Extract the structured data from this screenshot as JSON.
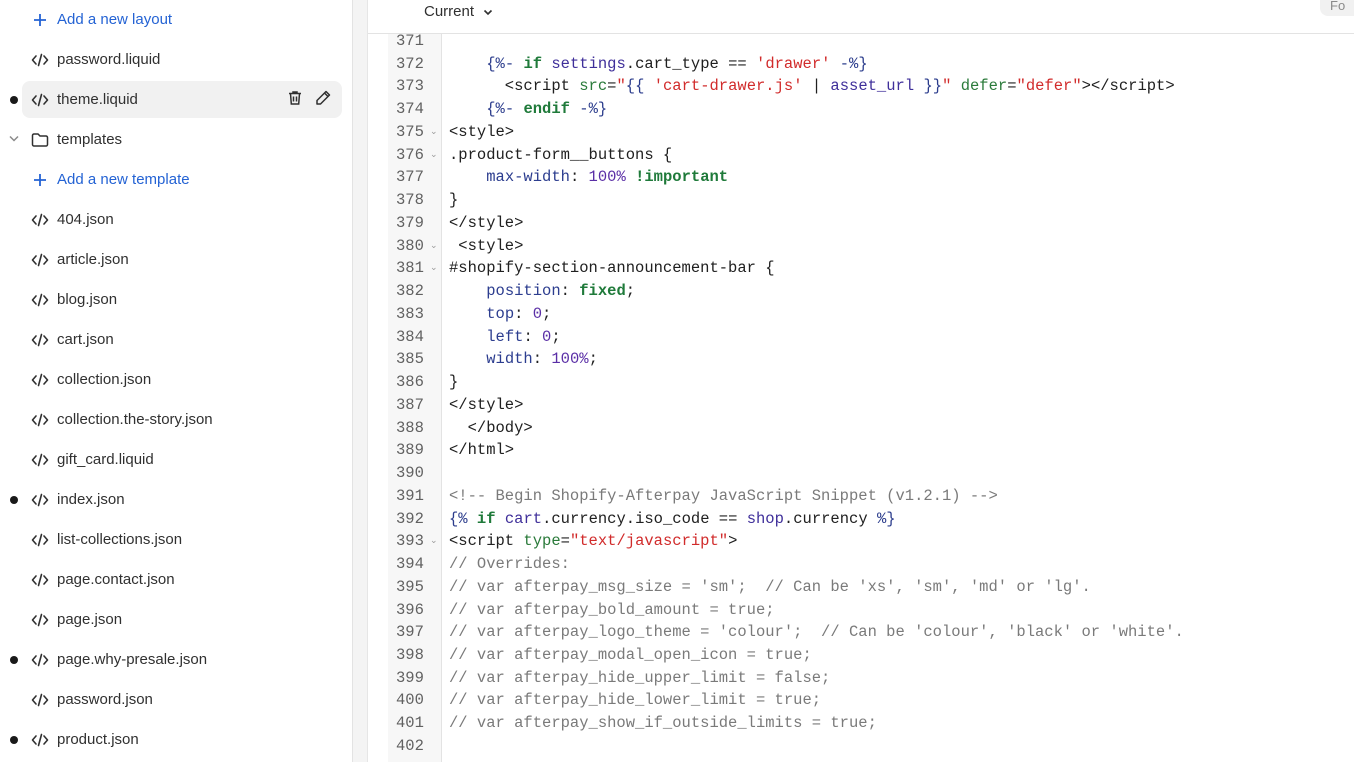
{
  "sidebar": {
    "items": [
      {
        "label": "Add a new layout",
        "type": "add"
      },
      {
        "label": "password.liquid",
        "type": "file"
      },
      {
        "label": "theme.liquid",
        "type": "file",
        "selected": true,
        "modified": true
      },
      {
        "label": "templates",
        "type": "folder"
      },
      {
        "label": "Add a new template",
        "type": "add"
      },
      {
        "label": "404.json",
        "type": "file"
      },
      {
        "label": "article.json",
        "type": "file"
      },
      {
        "label": "blog.json",
        "type": "file"
      },
      {
        "label": "cart.json",
        "type": "file"
      },
      {
        "label": "collection.json",
        "type": "file"
      },
      {
        "label": "collection.the-story.json",
        "type": "file"
      },
      {
        "label": "gift_card.liquid",
        "type": "file"
      },
      {
        "label": "index.json",
        "type": "file",
        "modified": true
      },
      {
        "label": "list-collections.json",
        "type": "file"
      },
      {
        "label": "page.contact.json",
        "type": "file"
      },
      {
        "label": "page.json",
        "type": "file"
      },
      {
        "label": "page.why-presale.json",
        "type": "file",
        "modified": true
      },
      {
        "label": "password.json",
        "type": "file"
      },
      {
        "label": "product.json",
        "type": "file",
        "modified": true
      }
    ]
  },
  "editor": {
    "version_label": "Current",
    "format_label": "Fo",
    "lines": [
      {
        "n": "371",
        "t": []
      },
      {
        "n": "372",
        "t": [
          [
            "",
            "    "
          ],
          [
            "del",
            "{%-"
          ],
          [
            "",
            " "
          ],
          [
            "kw",
            "if"
          ],
          [
            "",
            " "
          ],
          [
            "var",
            "settings"
          ],
          [
            "",
            ".cart_type == "
          ],
          [
            "str",
            "'drawer'"
          ],
          [
            "",
            " "
          ],
          [
            "del",
            "-%}"
          ]
        ]
      },
      {
        "n": "373",
        "t": [
          [
            "",
            "      <script "
          ],
          [
            "attr",
            "src"
          ],
          [
            "",
            "="
          ],
          [
            "str",
            "\""
          ],
          [
            "del",
            "{{"
          ],
          [
            "",
            " "
          ],
          [
            "str",
            "'cart-drawer.js'"
          ],
          [
            "",
            " | "
          ],
          [
            "var",
            "asset_url"
          ],
          [
            "",
            " "
          ],
          [
            "del",
            "}}"
          ],
          [
            "str",
            "\""
          ],
          [
            "",
            " "
          ],
          [
            "attr",
            "defer"
          ],
          [
            "",
            "="
          ],
          [
            "str",
            "\"defer\""
          ],
          [
            "",
            "></script>"
          ]
        ]
      },
      {
        "n": "374",
        "t": [
          [
            "",
            "    "
          ],
          [
            "del",
            "{%-"
          ],
          [
            "",
            " "
          ],
          [
            "kw",
            "endif"
          ],
          [
            "",
            " "
          ],
          [
            "del",
            "-%}"
          ]
        ]
      },
      {
        "n": "375",
        "fold": true,
        "t": [
          [
            "",
            "<style>"
          ]
        ]
      },
      {
        "n": "376",
        "fold": true,
        "t": [
          [
            "",
            ".product-form__buttons {"
          ]
        ]
      },
      {
        "n": "377",
        "t": [
          [
            "",
            "    "
          ],
          [
            "prop",
            "max-width"
          ],
          [
            "",
            ": "
          ],
          [
            "num",
            "100%"
          ],
          [
            "",
            " "
          ],
          [
            "kw",
            "!important"
          ]
        ]
      },
      {
        "n": "378",
        "t": [
          [
            "",
            "}"
          ]
        ]
      },
      {
        "n": "379",
        "t": [
          [
            "",
            "</style>"
          ]
        ]
      },
      {
        "n": "380",
        "fold": true,
        "t": [
          [
            "",
            " <style>"
          ]
        ]
      },
      {
        "n": "381",
        "fold": true,
        "t": [
          [
            "",
            "#shopify-section-announcement-bar {"
          ]
        ]
      },
      {
        "n": "382",
        "t": [
          [
            "",
            "    "
          ],
          [
            "prop",
            "position"
          ],
          [
            "",
            ": "
          ],
          [
            "kw",
            "fixed"
          ],
          [
            "",
            ";"
          ]
        ]
      },
      {
        "n": "383",
        "t": [
          [
            "",
            "    "
          ],
          [
            "prop",
            "top"
          ],
          [
            "",
            ": "
          ],
          [
            "num",
            "0"
          ],
          [
            "",
            ";"
          ]
        ]
      },
      {
        "n": "384",
        "t": [
          [
            "",
            "    "
          ],
          [
            "prop",
            "left"
          ],
          [
            "",
            ": "
          ],
          [
            "num",
            "0"
          ],
          [
            "",
            ";"
          ]
        ]
      },
      {
        "n": "385",
        "t": [
          [
            "",
            "    "
          ],
          [
            "prop",
            "width"
          ],
          [
            "",
            ": "
          ],
          [
            "num",
            "100%"
          ],
          [
            "",
            ";"
          ]
        ]
      },
      {
        "n": "386",
        "t": [
          [
            "",
            "}"
          ]
        ]
      },
      {
        "n": "387",
        "t": [
          [
            "",
            "</style>"
          ]
        ]
      },
      {
        "n": "388",
        "t": [
          [
            "",
            "  </body>"
          ]
        ]
      },
      {
        "n": "389",
        "t": [
          [
            "",
            "</html>"
          ]
        ]
      },
      {
        "n": "390",
        "t": []
      },
      {
        "n": "391",
        "t": [
          [
            "com",
            "<!-- Begin Shopify-Afterpay JavaScript Snippet (v1.2.1) -->"
          ]
        ]
      },
      {
        "n": "392",
        "t": [
          [
            "del",
            "{%"
          ],
          [
            "",
            " "
          ],
          [
            "kw",
            "if"
          ],
          [
            "",
            " "
          ],
          [
            "var",
            "cart"
          ],
          [
            "",
            ".currency.iso_code == "
          ],
          [
            "var",
            "shop"
          ],
          [
            "",
            ".currency "
          ],
          [
            "del",
            "%}"
          ]
        ]
      },
      {
        "n": "393",
        "fold": true,
        "t": [
          [
            "",
            "<script "
          ],
          [
            "attr",
            "type"
          ],
          [
            "",
            "="
          ],
          [
            "str",
            "\"text/javascript\""
          ],
          [
            "",
            ">"
          ]
        ]
      },
      {
        "n": "394",
        "t": [
          [
            "com",
            "// Overrides:"
          ]
        ]
      },
      {
        "n": "395",
        "t": [
          [
            "com",
            "// var afterpay_msg_size = 'sm';  // Can be 'xs', 'sm', 'md' or 'lg'."
          ]
        ]
      },
      {
        "n": "396",
        "t": [
          [
            "com",
            "// var afterpay_bold_amount = true;"
          ]
        ]
      },
      {
        "n": "397",
        "t": [
          [
            "com",
            "// var afterpay_logo_theme = 'colour';  // Can be 'colour', 'black' or 'white'."
          ]
        ]
      },
      {
        "n": "398",
        "t": [
          [
            "com",
            "// var afterpay_modal_open_icon = true;"
          ]
        ]
      },
      {
        "n": "399",
        "t": [
          [
            "com",
            "// var afterpay_hide_upper_limit = false;"
          ]
        ]
      },
      {
        "n": "400",
        "t": [
          [
            "com",
            "// var afterpay_hide_lower_limit = true;"
          ]
        ]
      },
      {
        "n": "401",
        "t": [
          [
            "com",
            "// var afterpay_show_if_outside_limits = true;"
          ]
        ]
      },
      {
        "n": "402",
        "t": []
      }
    ]
  }
}
